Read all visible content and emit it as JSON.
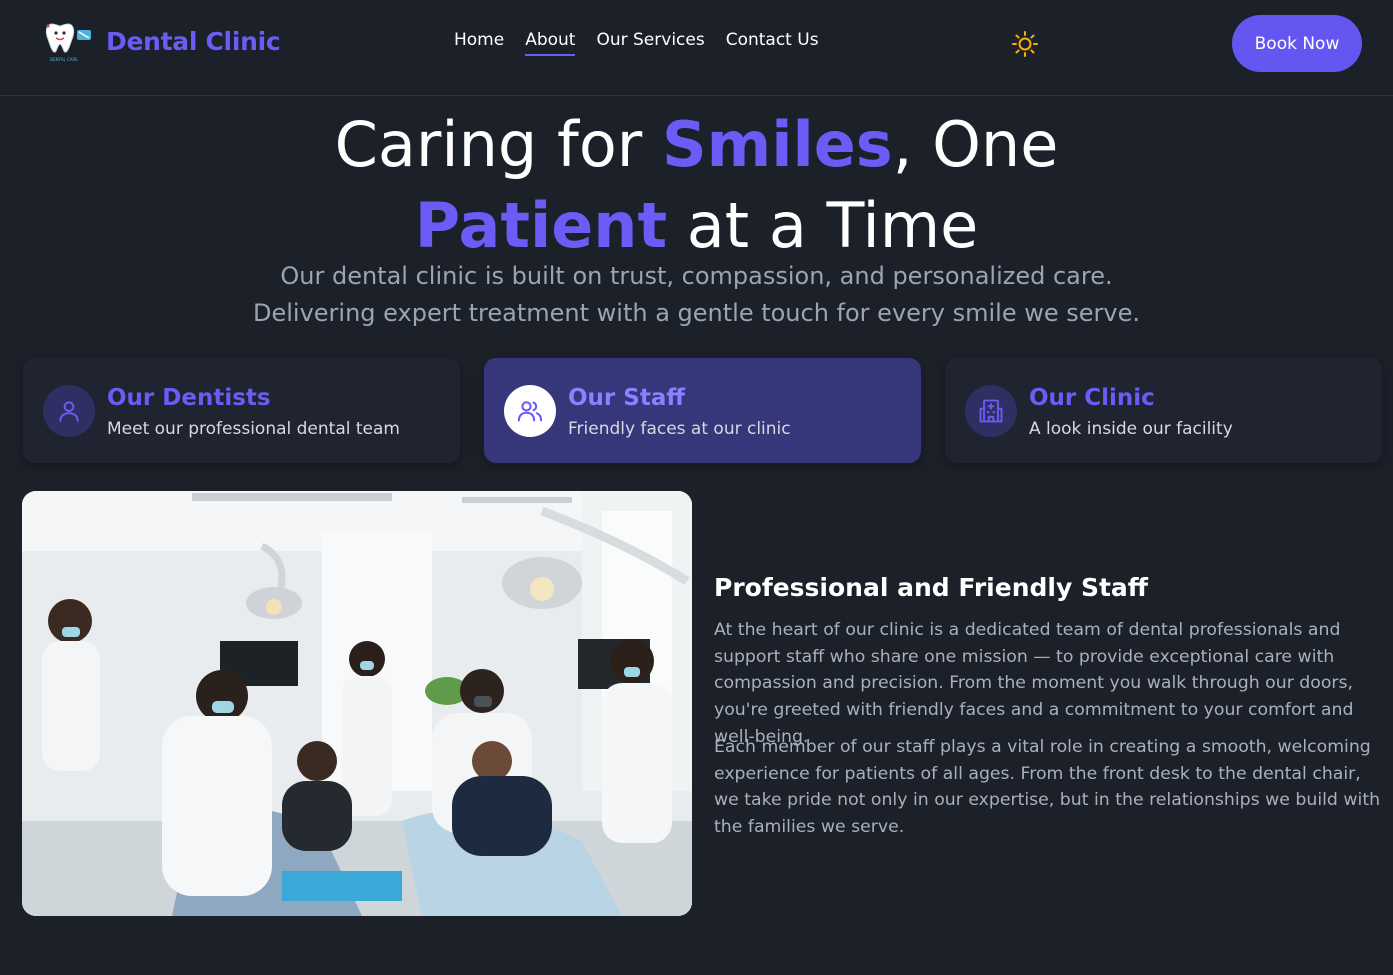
{
  "header": {
    "logo_text": "Dental Clinic",
    "logo_small_text": "DENTAL CARE",
    "nav": [
      {
        "label": "Home",
        "active": false
      },
      {
        "label": "About",
        "active": true
      },
      {
        "label": "Our Services",
        "active": false
      },
      {
        "label": "Contact Us",
        "active": false
      }
    ],
    "cta_label": "Book Now"
  },
  "hero": {
    "title_part1": "Caring for ",
    "title_highlight1": "Smiles",
    "title_part2": ", One",
    "title_highlight2": "Patient",
    "title_part3": " at a Time",
    "subtitle_line1": "Our dental clinic is built on trust, compassion, and personalized care.",
    "subtitle_line2": "Delivering expert treatment with a gentle touch for every smile we serve."
  },
  "cards": [
    {
      "title": "Our Dentists",
      "desc": "Meet our professional dental team",
      "icon": "user-icon",
      "active": false
    },
    {
      "title": "Our Staff",
      "desc": "Friendly faces at our clinic",
      "icon": "users-icon",
      "active": true
    },
    {
      "title": "Our Clinic",
      "desc": "A look inside our facility",
      "icon": "hospital-icon",
      "active": false
    }
  ],
  "content": {
    "title": "Professional and Friendly Staff",
    "para1": "At the heart of our clinic is a dedicated team of dental professionals and support staff who share one mission — to provide exceptional care with compassion and precision. From the moment you walk through our doors, you're greeted with friendly faces and a commitment to your comfort and well-being.",
    "para2": "Each member of our staff plays a vital role in creating a smooth, welcoming experience for patients of all ages. From the front desk to the dental chair, we take pride not only in our expertise, but in the relationships we build with the families we serve."
  },
  "colors": {
    "accent": "#6b5cf6",
    "background": "#1b2029",
    "card": "#1f2430",
    "card_active": "#35377a",
    "sun": "#f5b301"
  }
}
